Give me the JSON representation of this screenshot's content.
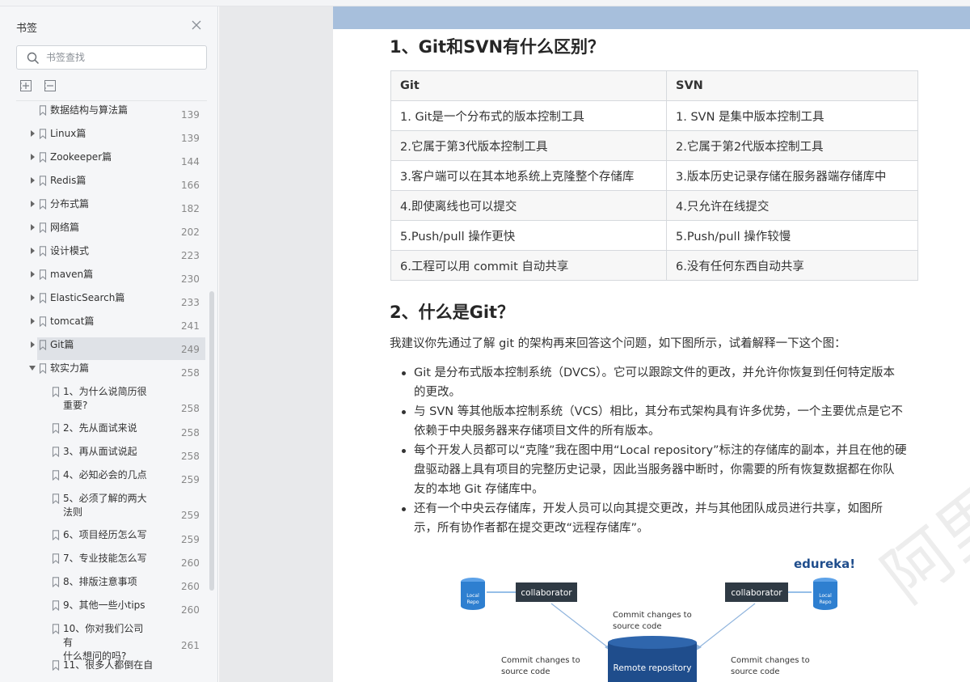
{
  "sidebar": {
    "title": "书签",
    "search_placeholder": "书签查找",
    "items": [
      {
        "label": "数据结构与算法篇",
        "page": "139",
        "level": 0,
        "expander": "none"
      },
      {
        "label": "Linux篇",
        "page": "139",
        "level": 0,
        "expander": "collapsed"
      },
      {
        "label": "Zookeeper篇",
        "page": "144",
        "level": 0,
        "expander": "collapsed"
      },
      {
        "label": "Redis篇",
        "page": "166",
        "level": 0,
        "expander": "collapsed"
      },
      {
        "label": "分布式篇",
        "page": "182",
        "level": 0,
        "expander": "collapsed"
      },
      {
        "label": "网络篇",
        "page": "202",
        "level": 0,
        "expander": "collapsed"
      },
      {
        "label": "设计模式",
        "page": "223",
        "level": 0,
        "expander": "collapsed"
      },
      {
        "label": "maven篇",
        "page": "230",
        "level": 0,
        "expander": "collapsed"
      },
      {
        "label": "ElasticSearch篇",
        "page": "233",
        "level": 0,
        "expander": "collapsed"
      },
      {
        "label": "tomcat篇",
        "page": "241",
        "level": 0,
        "expander": "collapsed"
      },
      {
        "label": "Git篇",
        "page": "249",
        "level": 0,
        "expander": "collapsed",
        "active": true
      },
      {
        "label": "软实力篇",
        "page": "258",
        "level": 0,
        "expander": "expanded"
      },
      {
        "label": "1、为什么说简历很重要?",
        "page": "258",
        "level": 1,
        "lines": [
          "1、为什么说简历很",
          "重要?"
        ]
      },
      {
        "label": "2、先从面试来说",
        "page": "258",
        "level": 1
      },
      {
        "label": "3、再从面试说起",
        "page": "258",
        "level": 1
      },
      {
        "label": "4、必知必会的几点",
        "page": "259",
        "level": 1
      },
      {
        "label": "5、必须了解的两大法则",
        "page": "259",
        "level": 1,
        "lines": [
          "5、必须了解的两大",
          "法则"
        ]
      },
      {
        "label": "6、项目经历怎么写",
        "page": "259",
        "level": 1
      },
      {
        "label": "7、专业技能怎么写",
        "page": "260",
        "level": 1
      },
      {
        "label": "8、排版注意事项",
        "page": "260",
        "level": 1
      },
      {
        "label": "9、其他一些小tips",
        "page": "260",
        "level": 1
      },
      {
        "label": "10、你对我们公司有什么想问的吗?",
        "page": "261",
        "level": 1,
        "lines": [
          "10、你对我们公司有",
          "什么想问的吗?"
        ]
      },
      {
        "label": "11、很多人都倒在自",
        "page": "",
        "level": 1
      }
    ]
  },
  "document": {
    "q1_heading": "1、Git和SVN有什么区别？",
    "table": {
      "headers": [
        "Git",
        "SVN"
      ],
      "rows": [
        [
          "1. Git是一个分布式的版本控制工具",
          "1. SVN 是集中版本控制工具"
        ],
        [
          "2.它属于第3代版本控制工具",
          "2.它属于第2代版本控制工具"
        ],
        [
          "3.客户端可以在其本地系统上克隆整个存储库",
          "3.版本历史记录存储在服务器端存储库中"
        ],
        [
          "4.即使离线也可以提交",
          "4.只允许在线提交"
        ],
        [
          "5.Push/pull 操作更快",
          "5.Push/pull 操作较慢"
        ],
        [
          "6.工程可以用 commit 自动共享",
          "6.没有任何东西自动共享"
        ]
      ]
    },
    "q2_heading": "2、什么是Git？",
    "intro": "我建议你先通过了解 git 的架构再来回答这个问题，如下图所示，试着解释一下这个图：",
    "bullets": [
      "Git 是分布式版本控制系统（DVCS）。它可以跟踪文件的更改，并允许你恢复到任何特定版本的更改。",
      "与 SVN 等其他版本控制系统（VCS）相比，其分布式架构具有许多优势，一个主要优点是它不依赖于中央服务器来存储项目文件的所有版本。",
      "每个开发人员都可以“克隆”我在图中用“Local repository”标注的存储库的副本，并且在他的硬盘驱动器上具有项目的完整历史记录，因此当服务器中断时，你需要的所有恢复数据都在你队友的本地 Git 存储库中。",
      "还有一个中央云存储库，开发人员可以向其提交更改，并与其他团队成员进行共享，如图所示，所有协作者都在提交更改“远程存储库”。"
    ],
    "bullet_lines": [
      [
        "Git 是分布式版本控制系统（DVCS）。它可以跟踪文件的更改，并允许你恢复到任何特定版本",
        "的更改。"
      ],
      [
        "与 SVN 等其他版本控制系统（VCS）相比，其分布式架构具有许多优势，一个主要优点是它不",
        "依赖于中央服务器来存储项目文件的所有版本。"
      ],
      [
        "每个开发人员都可以“克隆”我在图中用“Local repository”标注的存储库的副本，并且在他的硬",
        "盘驱动器上具有项目的完整历史记录，因此当服务器中断时，你需要的所有恢复数据都在你队",
        "友的本地 Git 存储库中。"
      ],
      [
        "还有一个中央云存储库，开发人员可以向其提交更改，并与其他团队成员进行共享，如图所",
        "示，所有协作者都在提交更改“远程存储库”。"
      ]
    ],
    "diagram": {
      "brand": "edureka!",
      "collaborator_label": "collaborator",
      "local_repo_label": [
        "Local",
        "Repo"
      ],
      "commit_label": [
        "Commit changes to",
        "source code"
      ],
      "remote_label": "Remote repository"
    },
    "watermark": "阿里内部资料"
  },
  "colors": {
    "page_band": "#a7bfdc",
    "edureka_blue": "#1f4d8c",
    "repo_blue": "#2e7fd0",
    "collaborator_dark": "#2f3a44"
  }
}
